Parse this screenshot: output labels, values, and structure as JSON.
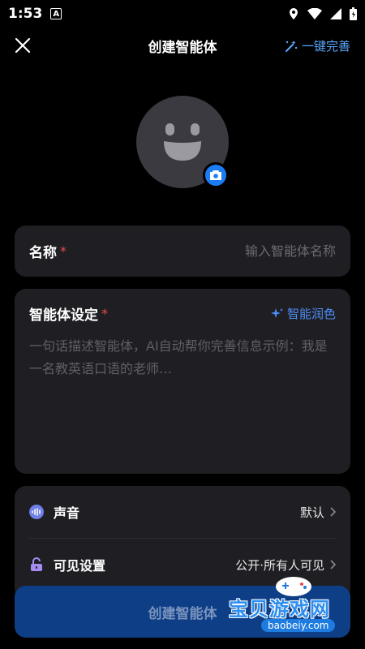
{
  "status": {
    "time": "1:53",
    "notif": "A"
  },
  "header": {
    "title": "创建智能体",
    "autocomplete_label": "一键完善"
  },
  "name_field": {
    "label": "名称",
    "required_mark": "*",
    "placeholder": "输入智能体名称",
    "value": ""
  },
  "setting_field": {
    "label": "智能体设定",
    "required_mark": "*",
    "polish_label": "智能润色",
    "placeholder": "一句话描述智能体，AI自动帮你完善信息示例：我是一名教英语口语的老师…",
    "value": ""
  },
  "options": [
    {
      "label": "声音",
      "value": "默认",
      "icon": "voice-icon"
    },
    {
      "label": "可见设置",
      "value": "公开·所有人可见",
      "icon": "lock-icon"
    }
  ],
  "create_button_label": "创建智能体",
  "watermark": {
    "title": "宝贝游戏网",
    "url": "baobeiy.com"
  },
  "colors": {
    "accent": "#1b7cf4",
    "link": "#5aa9ff",
    "card": "#1f1f23",
    "button": "#0e3f86",
    "required": "#e84a4a"
  }
}
